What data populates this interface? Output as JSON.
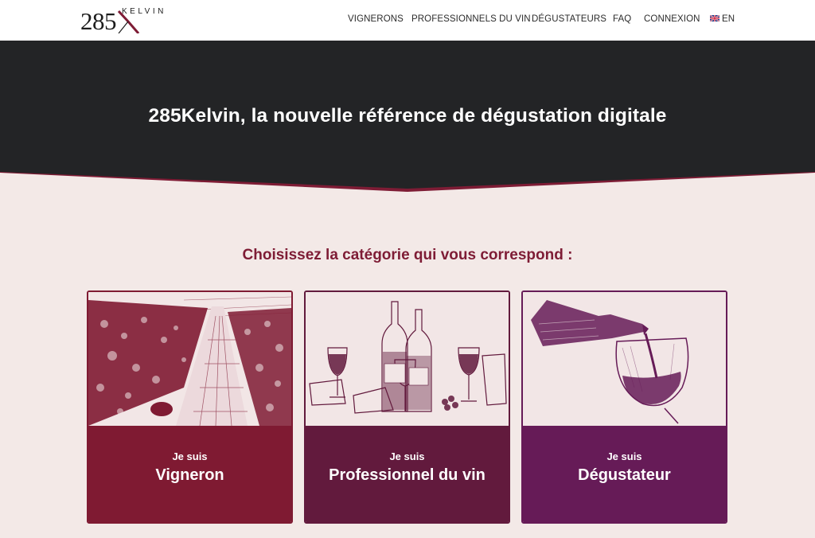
{
  "logo": {
    "number": "285",
    "word": "KELVIN"
  },
  "nav": {
    "items": [
      {
        "label": "VIGNERONS"
      },
      {
        "label": "PROFESSIONNELS DU VIN"
      },
      {
        "label": "DÉGUSTATEURS"
      },
      {
        "label": "FAQ"
      },
      {
        "label": "CONNEXION"
      }
    ],
    "language": {
      "label": "EN",
      "icon": "uk-flag-icon"
    }
  },
  "hero": {
    "title": "285Kelvin, la nouvelle référence de dégustation digitale"
  },
  "section": {
    "subtitle": "Choisissez la catégorie qui vous correspond :"
  },
  "cards": [
    {
      "prefix": "Je suis",
      "label": "Vigneron",
      "image": "vineyard-illustration",
      "color": "#7f1a32"
    },
    {
      "prefix": "Je suis",
      "label": "Professionnel du vin",
      "image": "wine-bottles-cheese-illustration",
      "color": "#621a3d"
    },
    {
      "prefix": "Je suis",
      "label": "Dégustateur",
      "image": "wine-pouring-glass-illustration",
      "color": "#661b57"
    }
  ],
  "colors": {
    "dark": "#232426",
    "accent": "#7e1c35",
    "background": "#f3e9e7"
  }
}
